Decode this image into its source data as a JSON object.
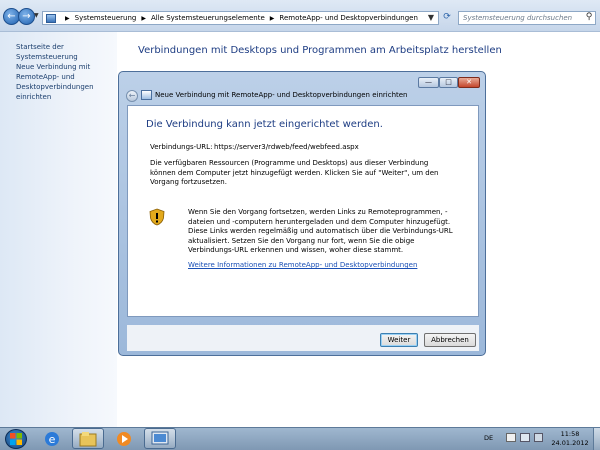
{
  "addressbar": {
    "breadcrumb": [
      "Systemsteuerung",
      "Alle Systemsteuerungselemente",
      "RemoteApp- und Desktopverbindungen"
    ],
    "search_placeholder": "Systemsteuerung durchsuchen"
  },
  "sidebar": {
    "items": [
      {
        "label": "Startseite der Systemsteuerung"
      },
      {
        "label": "Neue Verbindung mit RemoteApp- und Desktopverbindungen einrichten"
      }
    ]
  },
  "main": {
    "heading": "Verbindungen mit Desktops und Programmen am Arbeitsplatz herstellen"
  },
  "dialog": {
    "title": "Neue Verbindung mit RemoteApp- und Desktopverbindungen einrichten",
    "heading": "Die Verbindung kann jetzt eingerichtet werden.",
    "url_label": "Verbindungs-URL:",
    "url_value": "https://server3/rdweb/feed/webfeed.aspx",
    "description": "Die verfügbaren Ressourcen (Programme und Desktops) aus dieser Verbindung können dem Computer jetzt hinzugefügt werden. Klicken Sie auf \"Weiter\", um den Vorgang fortzusetzen.",
    "warning": "Wenn Sie den Vorgang fortsetzen, werden Links zu Remoteprogrammen, -dateien und -computern heruntergeladen und dem Computer hinzugefügt. Diese Links werden regelmäßig und automatisch über die Verbindungs-URL aktualisiert. Setzen Sie den Vorgang nur fort, wenn Sie die obige Verbindungs-URL erkennen und wissen, woher diese stammt.",
    "link": "Weitere Informationen zu RemoteApp- und Desktopverbindungen",
    "next_button": "Weiter",
    "cancel_button": "Abbrechen"
  },
  "taskbar": {
    "language": "DE",
    "time": "11:58",
    "date": "24.01.2012"
  },
  "colors": {
    "accent_heading": "#1e3d83",
    "link": "#1a4fb5"
  }
}
